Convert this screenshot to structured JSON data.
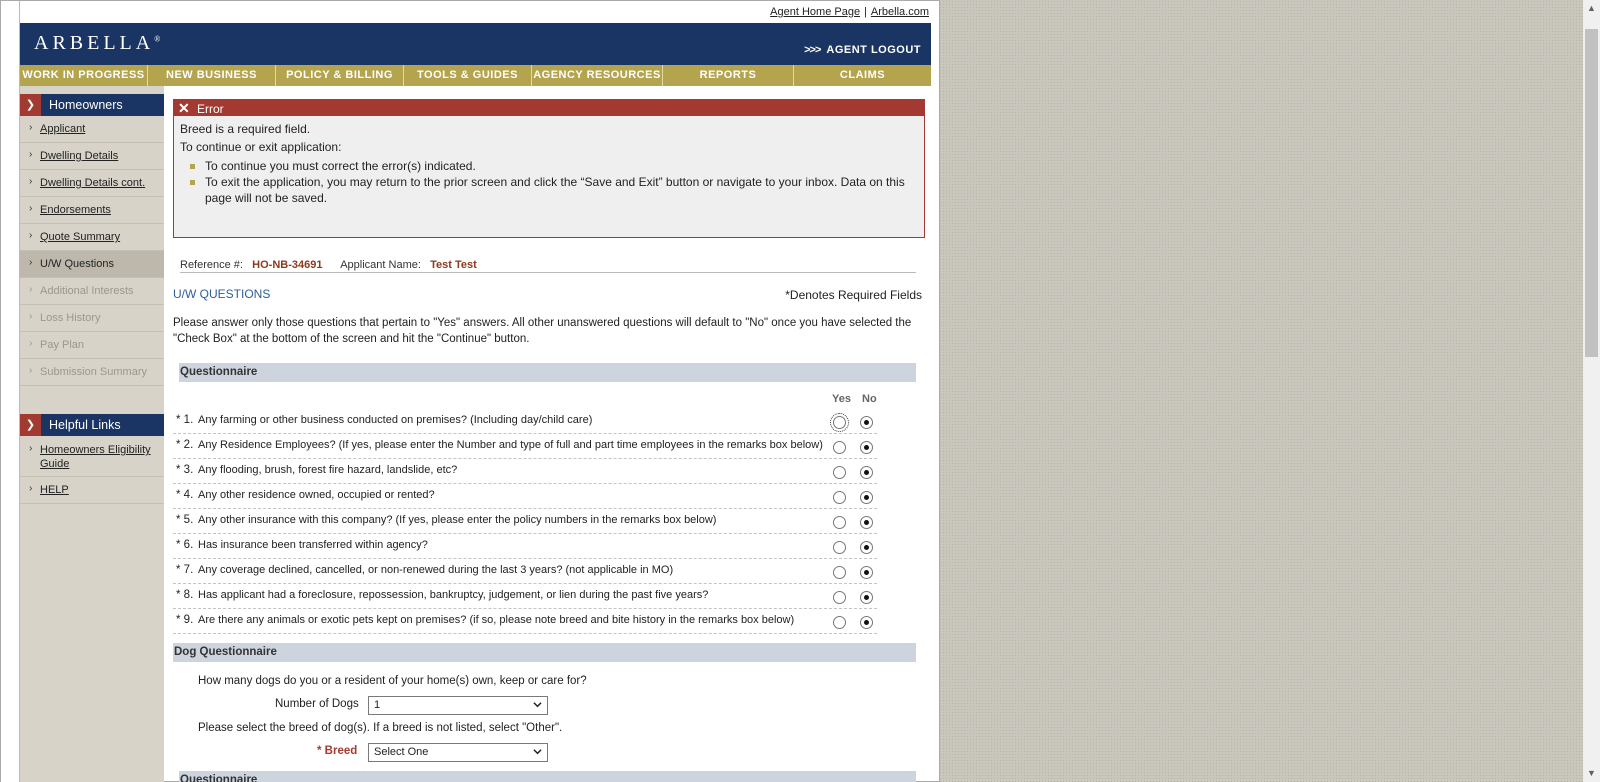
{
  "top_links": {
    "agent_home": "Agent Home Page",
    "separator": "|",
    "arbella_com": "Arbella.com"
  },
  "header": {
    "logo": "ARBELLA",
    "logo_mark": "®",
    "logout_arrows": ">>>",
    "logout": "AGENT LOGOUT"
  },
  "nav": [
    "WORK IN PROGRESS",
    "NEW BUSINESS",
    "POLICY & BILLING",
    "TOOLS & GUIDES",
    "AGENCY RESOURCES",
    "REPORTS",
    "CLAIMS"
  ],
  "sidebar": {
    "section_title": "Homeowners",
    "items": [
      {
        "label": "Applicant",
        "state": "link"
      },
      {
        "label": "Dwelling Details",
        "state": "link"
      },
      {
        "label": "Dwelling Details cont.",
        "state": "link"
      },
      {
        "label": "Endorsements",
        "state": "link"
      },
      {
        "label": "Quote Summary",
        "state": "link"
      },
      {
        "label": "U/W Questions",
        "state": "current"
      },
      {
        "label": "Additional Interests",
        "state": "disabled"
      },
      {
        "label": "Loss History",
        "state": "disabled"
      },
      {
        "label": "Pay Plan",
        "state": "disabled"
      },
      {
        "label": "Submission Summary",
        "state": "disabled"
      }
    ],
    "helpful_title": "Helpful Links",
    "helpful_links": [
      "Homeowners Eligibility",
      "Guide",
      "HELP"
    ]
  },
  "error": {
    "title": "Error",
    "line1": "Breed is a required field.",
    "line2": "To continue or exit application:",
    "bullet1": "To continue you must correct the error(s) indicated.",
    "bullet2a": "To exit the application, you may return to the prior screen and click the “Save and Exit” button or navigate to your inbox. Data on this",
    "bullet2b": "page will not be saved."
  },
  "reference": {
    "ref_label": "Reference #:",
    "ref_value": "HO-NB-34691",
    "name_label": "Applicant Name:",
    "name_value": "Test Test"
  },
  "uw": {
    "title": "U/W QUESTIONS",
    "required_note": "*Denotes Required Fields",
    "intro1": "Please answer only those questions that pertain to \"Yes\" answers. All other unanswered questions will default to \"No\" once you have selected the",
    "intro2": "\"Check Box\" at the bottom of the screen and hit the \"Continue\" button.",
    "section": "Questionnaire",
    "yes_label": "Yes",
    "no_label": "No",
    "questions": [
      {
        "num": "* 1.",
        "text": "Any farming or other business conducted on premises? (Including day/child care)",
        "answer": "No"
      },
      {
        "num": "* 2.",
        "text": "Any Residence Employees? (If yes, please enter the Number and type of full and part time employees in the remarks box below)",
        "answer": "No"
      },
      {
        "num": "* 3.",
        "text": "Any flooding, brush, forest fire hazard, landslide, etc?",
        "answer": "No"
      },
      {
        "num": "* 4.",
        "text": "Any other residence owned, occupied or rented?",
        "answer": "No"
      },
      {
        "num": "* 5.",
        "text": "Any other insurance with this company? (If yes, please enter the policy numbers in the remarks box below)",
        "answer": "No"
      },
      {
        "num": "* 6.",
        "text": "Has insurance been transferred within agency?",
        "answer": "No"
      },
      {
        "num": "* 7.",
        "text": "Any coverage declined, cancelled, or non-renewed during the last 3 years? (not applicable in MO)",
        "answer": "No"
      },
      {
        "num": "* 8.",
        "text": "Has applicant had a foreclosure, repossession, bankruptcy, judgement, or lien during the past five years?",
        "answer": "No"
      },
      {
        "num": "* 9.",
        "text": "Are there any animals or exotic pets kept on premises? (if so, please note breed and bite history in the remarks box below)",
        "answer": "No"
      }
    ]
  },
  "dog": {
    "section": "Dog Questionnaire",
    "question": "How many dogs do you or a resident of your home(s) own, keep or care for?",
    "number_label": "Number of Dogs",
    "number_value": "1",
    "breed_note": "Please select the breed of dog(s). If a breed is not listed, select \"Other\".",
    "breed_label": "* Breed",
    "breed_value": "Select One",
    "next_section": "Questionnaire"
  }
}
